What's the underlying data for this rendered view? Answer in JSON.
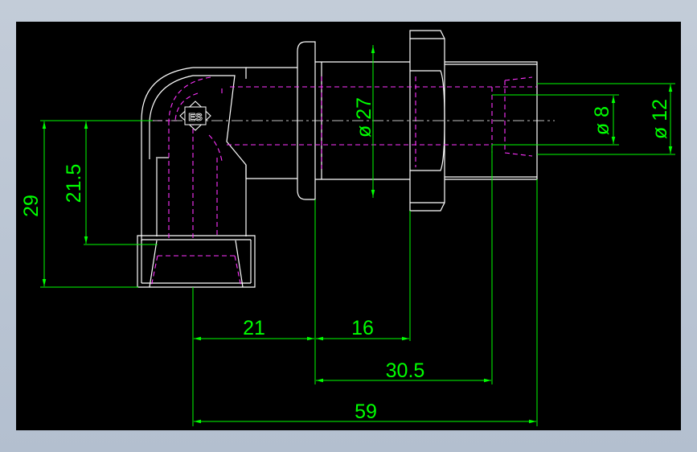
{
  "colors": {
    "background": "#000000",
    "frame": "#b9c4d2",
    "outline": "#ffffff",
    "hidden_lines": "#ff33ff",
    "dimensions": "#00ff00"
  },
  "dimensions": {
    "height_overall": "29",
    "height_center": "21.5",
    "dia_nut": "ø 27",
    "dia_bore": "ø 8",
    "dia_outer": "ø 12",
    "len_21": "21",
    "len_16": "16",
    "len_30_5": "30.5",
    "len_59": "59"
  },
  "marking": "ES"
}
